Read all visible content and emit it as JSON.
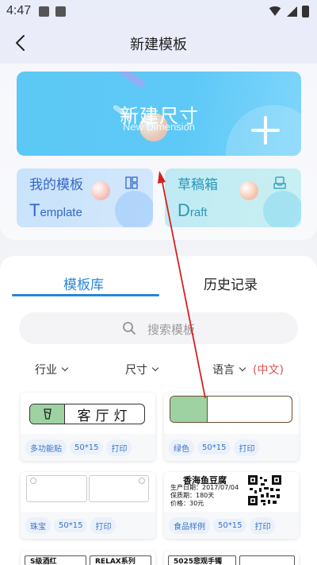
{
  "status_bar": {
    "time": "4:47"
  },
  "header": {
    "title": "新建模板"
  },
  "new_dimension": {
    "title": "新建尺寸",
    "subtitle": "New Dimension"
  },
  "my_templates": {
    "label": "我的模板",
    "en_first": "T",
    "en_rest": "emplate"
  },
  "drafts": {
    "label": "草稿箱",
    "en_first": "D",
    "en_rest": "raft"
  },
  "tabs": [
    {
      "label": "模板库",
      "active": true
    },
    {
      "label": "历史记录",
      "active": false
    }
  ],
  "search": {
    "placeholder": "搜索模板"
  },
  "filters": {
    "industry": "行业",
    "size": "尺寸",
    "language": "语言",
    "language_selected": "(中文)"
  },
  "templates": [
    {
      "preview_text": "客厅灯",
      "tags": [
        "多功能贴",
        "50*15",
        "打印"
      ]
    },
    {
      "preview_text": "",
      "tags": [
        "绿色",
        "50*15",
        "打印"
      ]
    },
    {
      "preview_text": "",
      "tags": [
        "珠宝",
        "50*15",
        "打印"
      ]
    },
    {
      "preview_text": "香海鱼豆腐",
      "rows": [
        "生产日期：2017/07/04",
        "保质期：180天",
        "价格：30元"
      ],
      "tags": [
        "食品样例",
        "50*15",
        "打印"
      ]
    },
    {
      "preview_text": "",
      "header_cells": [
        "S级酒红",
        "RELAX系列"
      ],
      "tags": []
    },
    {
      "preview_text": "",
      "header_cells": [
        "5025悲观手镯"
      ],
      "tags": []
    }
  ],
  "colors": {
    "accent": "#2a86d6",
    "label_green": "#9fd2a2",
    "language_red": "#e05252",
    "annotation": "#d6201f"
  }
}
